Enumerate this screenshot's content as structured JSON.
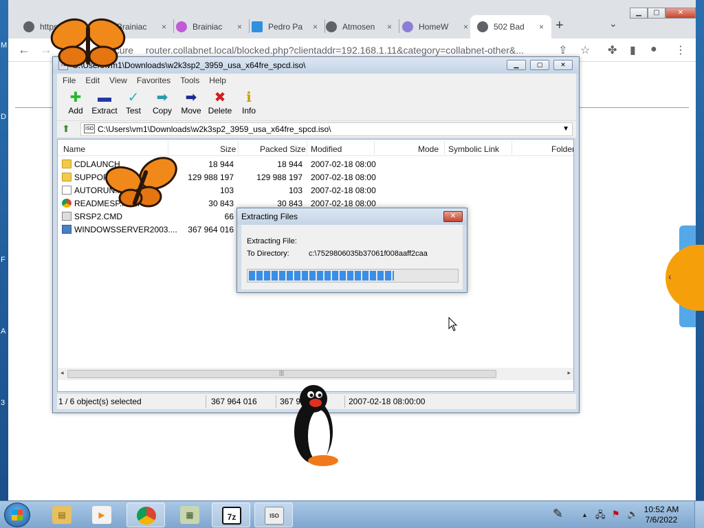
{
  "desktop": {
    "left_letters": [
      "M",
      "D",
      "F",
      "A",
      "3"
    ]
  },
  "browser": {
    "tabs": [
      {
        "label": "https://",
        "close": "×",
        "color": "#5f6368"
      },
      {
        "label": "Brainiac",
        "close": "×",
        "color": "#c25bd6"
      },
      {
        "label": "Brainiac",
        "close": "×",
        "color": "#c25bd6"
      },
      {
        "label": "Pedro Pa",
        "close": "×",
        "color": "#2f8fe3"
      },
      {
        "label": "Atmosen",
        "close": "×",
        "color": "#5f6368"
      },
      {
        "label": "HomeW",
        "close": "×",
        "color": "#8a7ed6"
      },
      {
        "label": "502 Bad",
        "close": "×",
        "color": "#5f6368"
      }
    ],
    "new_tab": "+",
    "tab_menu": "⌄",
    "win_min": "▁",
    "win_max": "▢",
    "win_close": "✕",
    "back": "←",
    "forward": "→",
    "security": "secure",
    "url": "router.collabnet.local/blocked.php?clientaddr=192.168.1.11&category=collabnet-other&...",
    "star": "☆",
    "side_chevron": "‹"
  },
  "sevenzip": {
    "title": "C:\\Users\\vm1\\Downloads\\w2k3sp2_3959_usa_x64fre_spcd.iso\\",
    "title_icon": "7z",
    "menu": [
      "File",
      "Edit",
      "View",
      "Favorites",
      "Tools",
      "Help"
    ],
    "tools": [
      {
        "label": "Add",
        "glyph": "✚",
        "color": "#2db52d"
      },
      {
        "label": "Extract",
        "glyph": "▬",
        "color": "#2338a8"
      },
      {
        "label": "Test",
        "glyph": "✓",
        "color": "#22b8c8"
      },
      {
        "label": "Copy",
        "glyph": "➡",
        "color": "#2a9ab0"
      },
      {
        "label": "Move",
        "glyph": "➡",
        "color": "#1a2a90"
      },
      {
        "label": "Delete",
        "glyph": "✖",
        "color": "#d41e1e"
      },
      {
        "label": "Info",
        "glyph": "ℹ",
        "color": "#c9a000"
      }
    ],
    "address": "C:\\Users\\vm1\\Downloads\\w2k3sp2_3959_usa_x64fre_spcd.iso\\",
    "address_icon": "ISO",
    "up_icon": "⬆",
    "dropdown": "▼",
    "columns": [
      "Name",
      "Size",
      "Packed Size",
      "Modified",
      "Mode",
      "Symbolic Link",
      "Folder"
    ],
    "rows": [
      {
        "name": "CDLAUNCH",
        "size": "18 944",
        "packed": "18 944",
        "modified": "2007-02-18 08:00",
        "type": "folder"
      },
      {
        "name": "SUPPORT",
        "size": "129 988 197",
        "packed": "129 988 197",
        "modified": "2007-02-18 08:00",
        "type": "folder"
      },
      {
        "name": "AUTORUN.INF",
        "size": "103",
        "packed": "103",
        "modified": "2007-02-18 08:00",
        "type": "file"
      },
      {
        "name": "READMESP.HTM",
        "size": "30 843",
        "packed": "30 843",
        "modified": "2007-02-18 08:00",
        "type": "chrome"
      },
      {
        "name": "SRSP2.CMD",
        "size": "66",
        "packed": "",
        "modified": "",
        "type": "cmd"
      },
      {
        "name": "WINDOWSSERVER2003....",
        "size": "367 964 016",
        "packed": "",
        "modified": "",
        "type": "iso"
      }
    ],
    "scroll_left": "◂",
    "scroll_right": "▸",
    "scroll_grip": "|||",
    "status": {
      "selected": "1 / 6 object(s) selected",
      "size": "367 964 016",
      "packed": "367 964 016",
      "modified": "2007-02-18 08:00:00"
    }
  },
  "dialog": {
    "title": "Extracting Files",
    "close": "✕",
    "file_label": "Extracting File:",
    "file_value": "",
    "dir_label": "To Directory:",
    "dir_value": "c:\\7529806035b37061f008aaff2caa",
    "progress": 0.7
  },
  "taskbar": {
    "apps": [
      {
        "name": "explorer",
        "glyph": "▤",
        "color": "#e8c060"
      },
      {
        "name": "media-player",
        "glyph": "▶",
        "color": "#f08a20"
      },
      {
        "name": "chrome",
        "glyph": "",
        "color": "#db4437"
      },
      {
        "name": "network-tool",
        "glyph": "▦",
        "color": "#6a8a4a"
      },
      {
        "name": "7zip",
        "glyph": "7z",
        "color": "#111111"
      },
      {
        "name": "iso-file",
        "glyph": "ISO",
        "color": "#bbbbbb"
      }
    ],
    "tray_up": "▲",
    "tray_network": "🖧",
    "tray_flag": "⚑",
    "tray_volume": "🔊",
    "time": "10:52 AM",
    "date": "7/6/2022"
  }
}
